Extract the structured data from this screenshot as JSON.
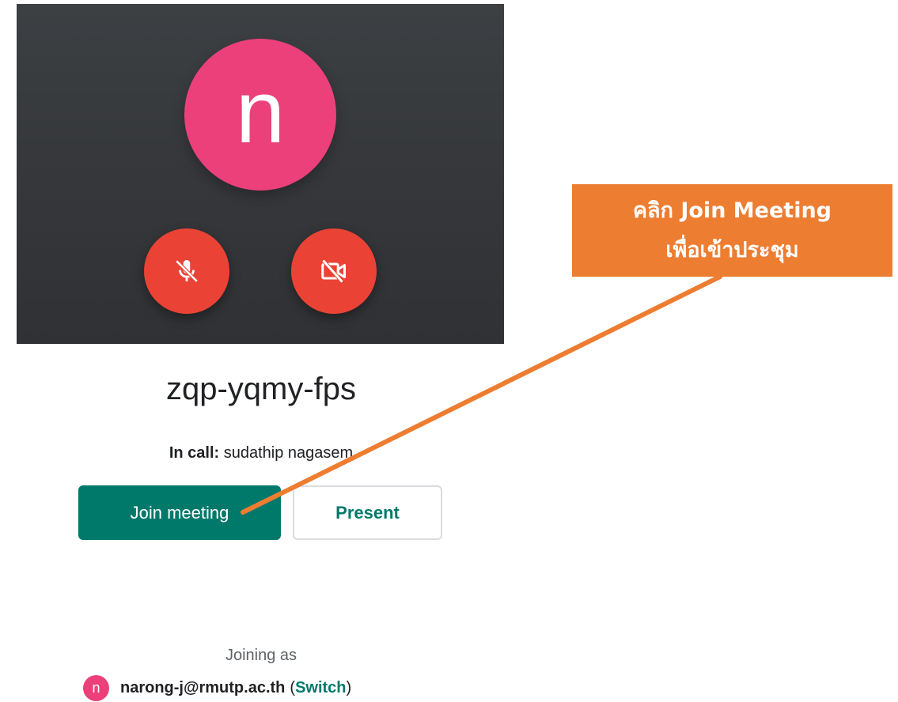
{
  "preview": {
    "avatar_initial": "n",
    "avatar_color": "#ec407a",
    "mic_state": "off",
    "camera_state": "off",
    "control_color": "#ea4335"
  },
  "meeting": {
    "code": "zqp-yqmy-fps",
    "in_call_label": "In call:",
    "in_call_name": "sudathip nagasem"
  },
  "actions": {
    "join_label": "Join meeting",
    "present_label": "Present",
    "accent_color": "#00796b"
  },
  "account": {
    "joining_as_label": "Joining as",
    "initial": "n",
    "email": "narong-j@rmutp.ac.th",
    "switch_label": "Switch"
  },
  "annotation": {
    "line1": "คลิก Join Meeting",
    "line2": "เพื่อเข้าประชุม",
    "color": "#ed7d31"
  }
}
